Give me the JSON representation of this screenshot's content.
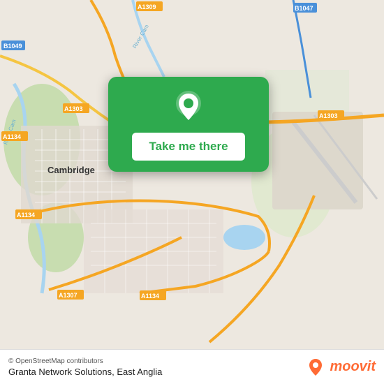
{
  "map": {
    "alt": "Map of Cambridge area"
  },
  "card": {
    "button_label": "Take me there"
  },
  "bottom_bar": {
    "attribution": "© OpenStreetMap contributors",
    "location_label": "Granta Network Solutions, East Anglia",
    "moovit_text": "moovit"
  },
  "roads": {
    "labels": [
      "B1049",
      "A1303",
      "A1134",
      "A1307",
      "A1309",
      "B1047",
      "A1303",
      "River Cam"
    ]
  }
}
